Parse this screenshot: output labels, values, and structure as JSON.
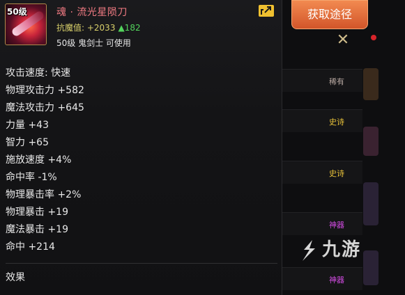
{
  "item": {
    "level_badge": "50级",
    "name": "魂 · 流光星陨刀",
    "resist_label": "抗魔值: ",
    "resist_value": "+2033",
    "resist_delta": "▲182",
    "requirement": "50级 鬼剑士 可使用"
  },
  "stats": [
    "攻击速度: 快速",
    "物理攻击力 +582",
    "魔法攻击力 +645",
    "力量 +43",
    "智力 +65",
    "施放速度 +4%",
    "命中率 -1%",
    "物理暴击率 +2%",
    "物理暴击 +19",
    "魔法暴击 +19",
    "命中 +214"
  ],
  "effect_label": "效果",
  "side": {
    "obtain_button": "获取途径",
    "slots": [
      {
        "label": "稀有",
        "color": "#b7a7a0"
      },
      {
        "label": "史诗",
        "color": "#e9c23a"
      },
      {
        "label": "史诗",
        "color": "#e9c23a"
      },
      {
        "label": "神器",
        "color": "#d04be0"
      },
      {
        "label": "神器",
        "color": "#d04be0"
      }
    ]
  },
  "watermark": "九游",
  "colors": {
    "item_name": "#f07a82",
    "resist": "#d8cf6a",
    "delta_up": "#52d35c",
    "button": "#e2703c"
  },
  "icons": [
    "share-icon",
    "close-icon",
    "item-icon",
    "jiuyou-logo-icon"
  ]
}
